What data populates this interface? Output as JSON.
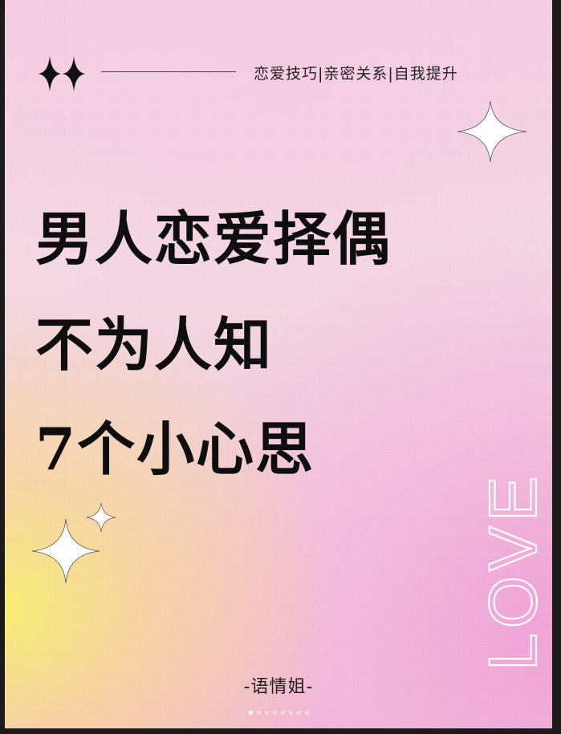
{
  "header": {
    "tagline": "恋爱技巧|亲密关系|自我提升"
  },
  "title": {
    "line1": "男人恋爱择偶",
    "line2": "不为人知",
    "line3": "7个小心思"
  },
  "decor": {
    "love_text": "LOVE",
    "sparkle_icons": [
      "sparkle-icon",
      "sparkle-icon",
      "sparkle-icon"
    ],
    "colors": {
      "yellow": "#f6f06e",
      "pink": "#f0a0d7",
      "ink": "#0e0e0e"
    }
  },
  "footer": {
    "author": "-语情姐-"
  },
  "pagination": {
    "total": 8,
    "current": 1
  }
}
